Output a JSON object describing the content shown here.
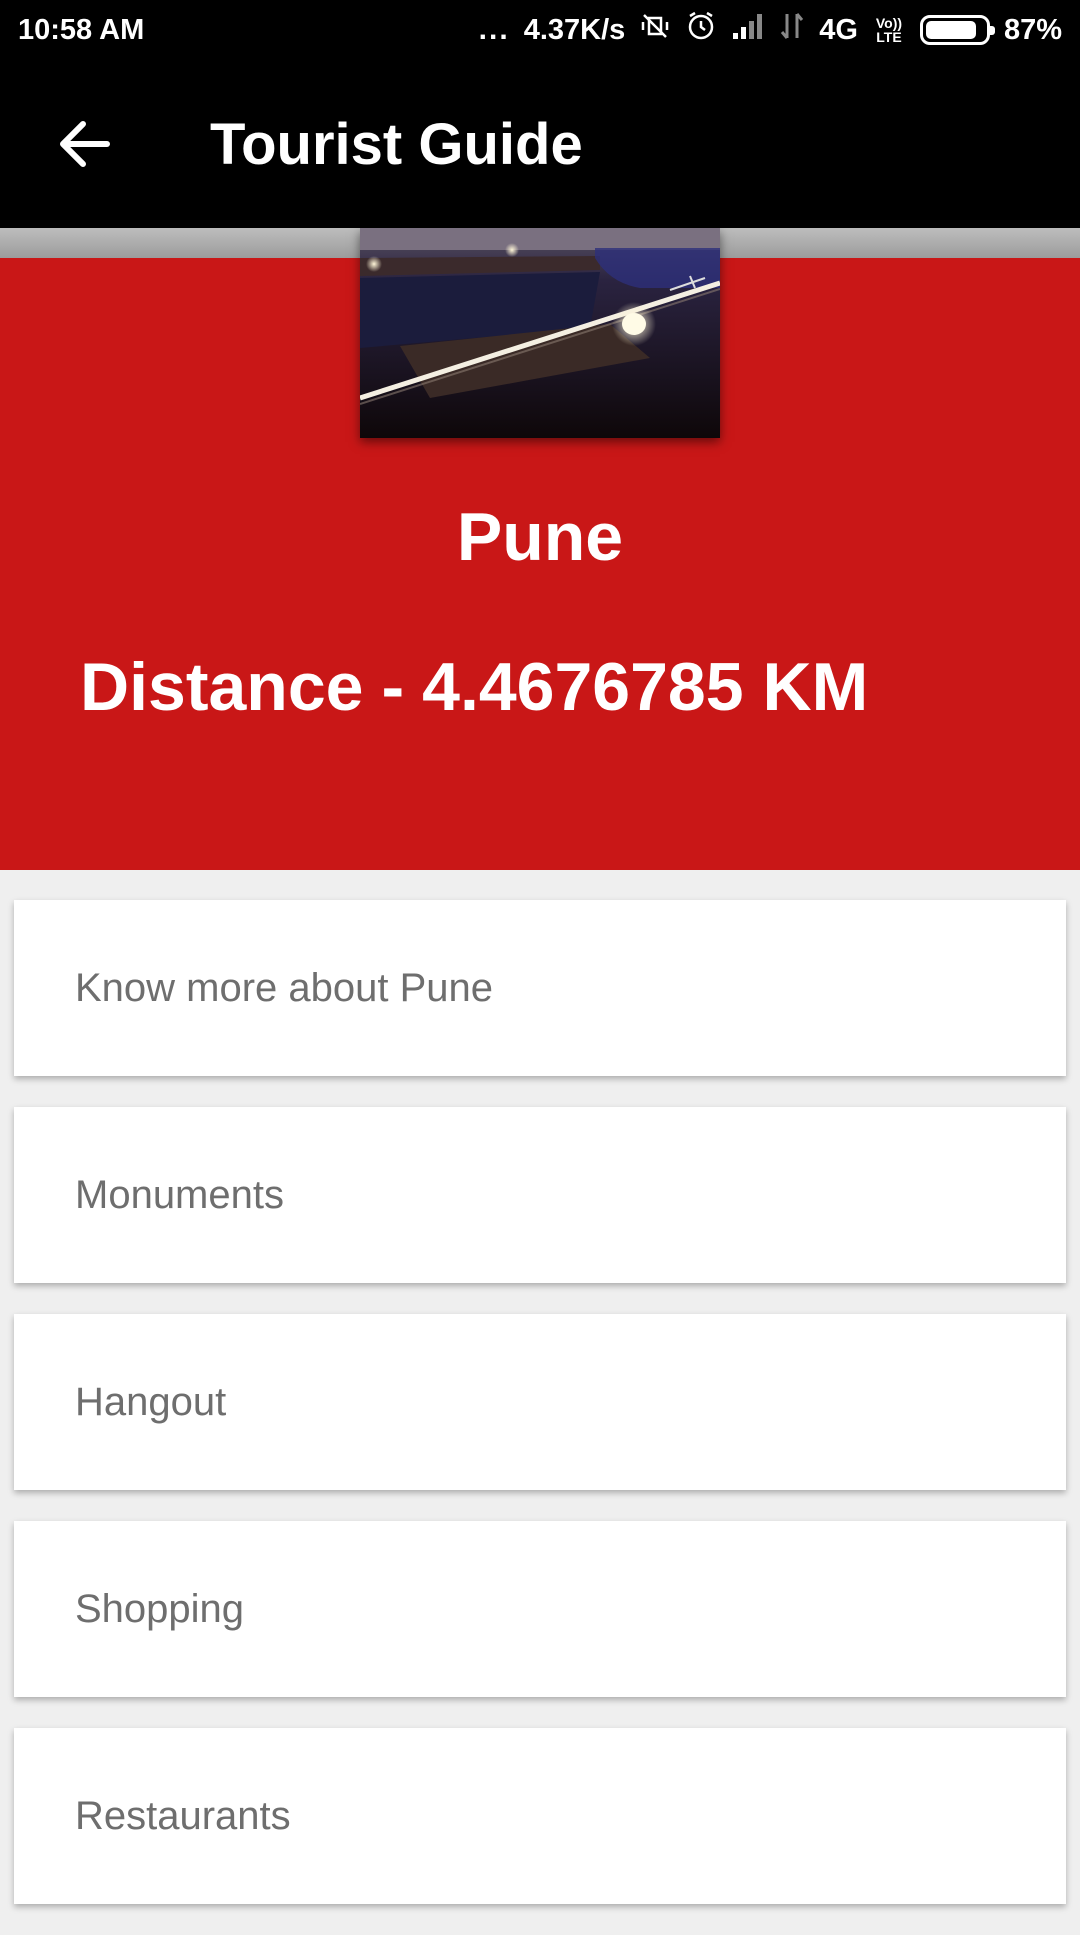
{
  "status_bar": {
    "time": "10:58 AM",
    "dots": "...",
    "speed": "4.37K/s",
    "network": "4G",
    "volte": "Vo)) LTE",
    "battery_text": "87%",
    "battery_level": 0.87
  },
  "app_bar": {
    "title": "Tourist Guide",
    "back_icon": "arrow-left-icon"
  },
  "hero": {
    "city": "Pune",
    "distance_label": "Distance",
    "distance_separator": "-",
    "distance_value": "4.4676785",
    "distance_unit": "KM",
    "accent_color": "#c91717"
  },
  "menu": {
    "items": [
      {
        "label": "Know more about Pune"
      },
      {
        "label": "Monuments"
      },
      {
        "label": "Hangout"
      },
      {
        "label": "Shopping"
      },
      {
        "label": "Restaurants"
      }
    ]
  }
}
